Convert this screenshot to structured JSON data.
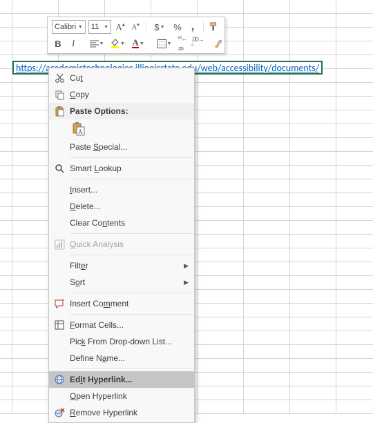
{
  "cell": {
    "hyperlink_text": "https://academictechnologies.illinoisstate.edu/web/accessibility/documents/"
  },
  "mini_toolbar": {
    "font_name": "Calibri",
    "font_size": "11",
    "currency": "$",
    "percent": "%",
    "comma": ",",
    "bold": "B",
    "italic": "I"
  },
  "context_menu": {
    "cut": "Cut",
    "copy": "Copy",
    "paste_options": "Paste Options:",
    "paste_special": "Paste Special...",
    "smart_lookup": "Smart Lookup",
    "insert": "Insert...",
    "delete": "Delete...",
    "clear_contents": "Clear Contents",
    "quick_analysis": "Quick Analysis",
    "filter": "Filter",
    "sort": "Sort",
    "insert_comment": "Insert Comment",
    "format_cells": "Format Cells...",
    "pick_from_list": "Pick From Drop-down List...",
    "define_name": "Define Name...",
    "edit_hyperlink": "Edit Hyperlink...",
    "open_hyperlink": "Open Hyperlink",
    "remove_hyperlink": "Remove Hyperlink"
  }
}
